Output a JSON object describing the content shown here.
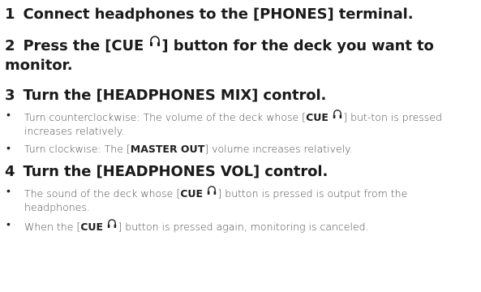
{
  "steps": [
    {
      "number": "1",
      "title": "Connect headphones to the [PHONES] terminal."
    },
    {
      "number": "2",
      "title_before_icon": "Press the [CUE ",
      "title_after_icon": "] button for the deck you want to monitor."
    },
    {
      "number": "3",
      "title": "Turn the [HEADPHONES MIX] control.",
      "bullets": [
        {
          "before": "Turn counterclockwise: The volume of the deck whose [",
          "bold": "CUE ",
          "after": "] but-ton is pressed increases relatively."
        },
        {
          "before": "Turn clockwise: The [",
          "bold": "MASTER OUT",
          "after": "] volume increases relatively."
        }
      ]
    },
    {
      "number": "4",
      "title": "Turn the [HEADPHONES VOL] control.",
      "bullets": [
        {
          "before": "The sound of the deck whose [",
          "bold": "CUE ",
          "after": "] button is pressed is output from the headphones."
        },
        {
          "before": "When the [",
          "bold": "CUE ",
          "after": "] button is pressed again, monitoring is canceled."
        }
      ]
    }
  ],
  "bullet_glyph": "•",
  "icons": {
    "headphones": "headphones-icon"
  }
}
